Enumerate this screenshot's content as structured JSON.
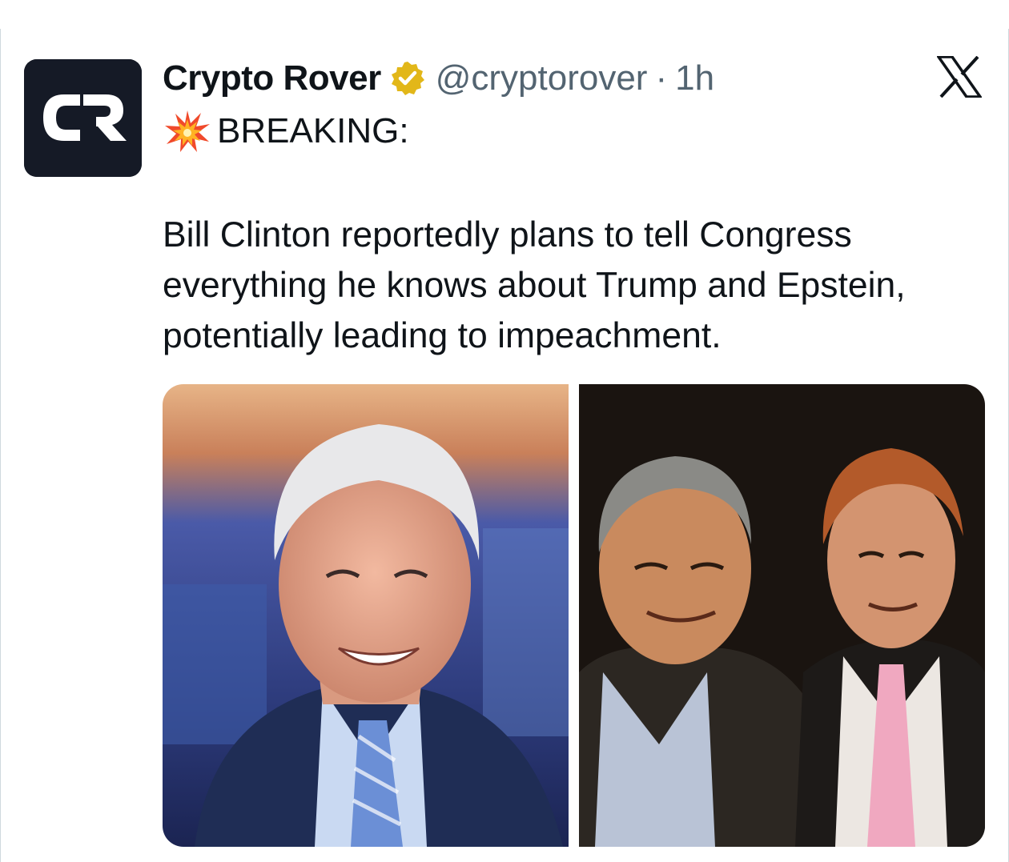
{
  "tweet": {
    "author": {
      "display_name": "Crypto Rover",
      "handle": "@cryptorover",
      "separator": "·",
      "time": "1h",
      "verified": true,
      "avatar_text": "CR"
    },
    "headline_icon": "collision-emoji",
    "headline": "BREAKING:",
    "body": "Bill Clinton reportedly plans to tell Congress everything he knows about Trump and Epstein, potentially leading to impeachment.",
    "media": [
      {
        "name": "photo-left",
        "description_icon": "portrait-photo"
      },
      {
        "name": "photo-right",
        "description_icon": "group-photo"
      }
    ]
  },
  "platform": {
    "logo_icon": "x-logo-icon"
  },
  "colors": {
    "text": "#0f1419",
    "secondary_text": "#536471",
    "verified_gold": "#e2b719",
    "avatar_bg": "#151a26"
  }
}
